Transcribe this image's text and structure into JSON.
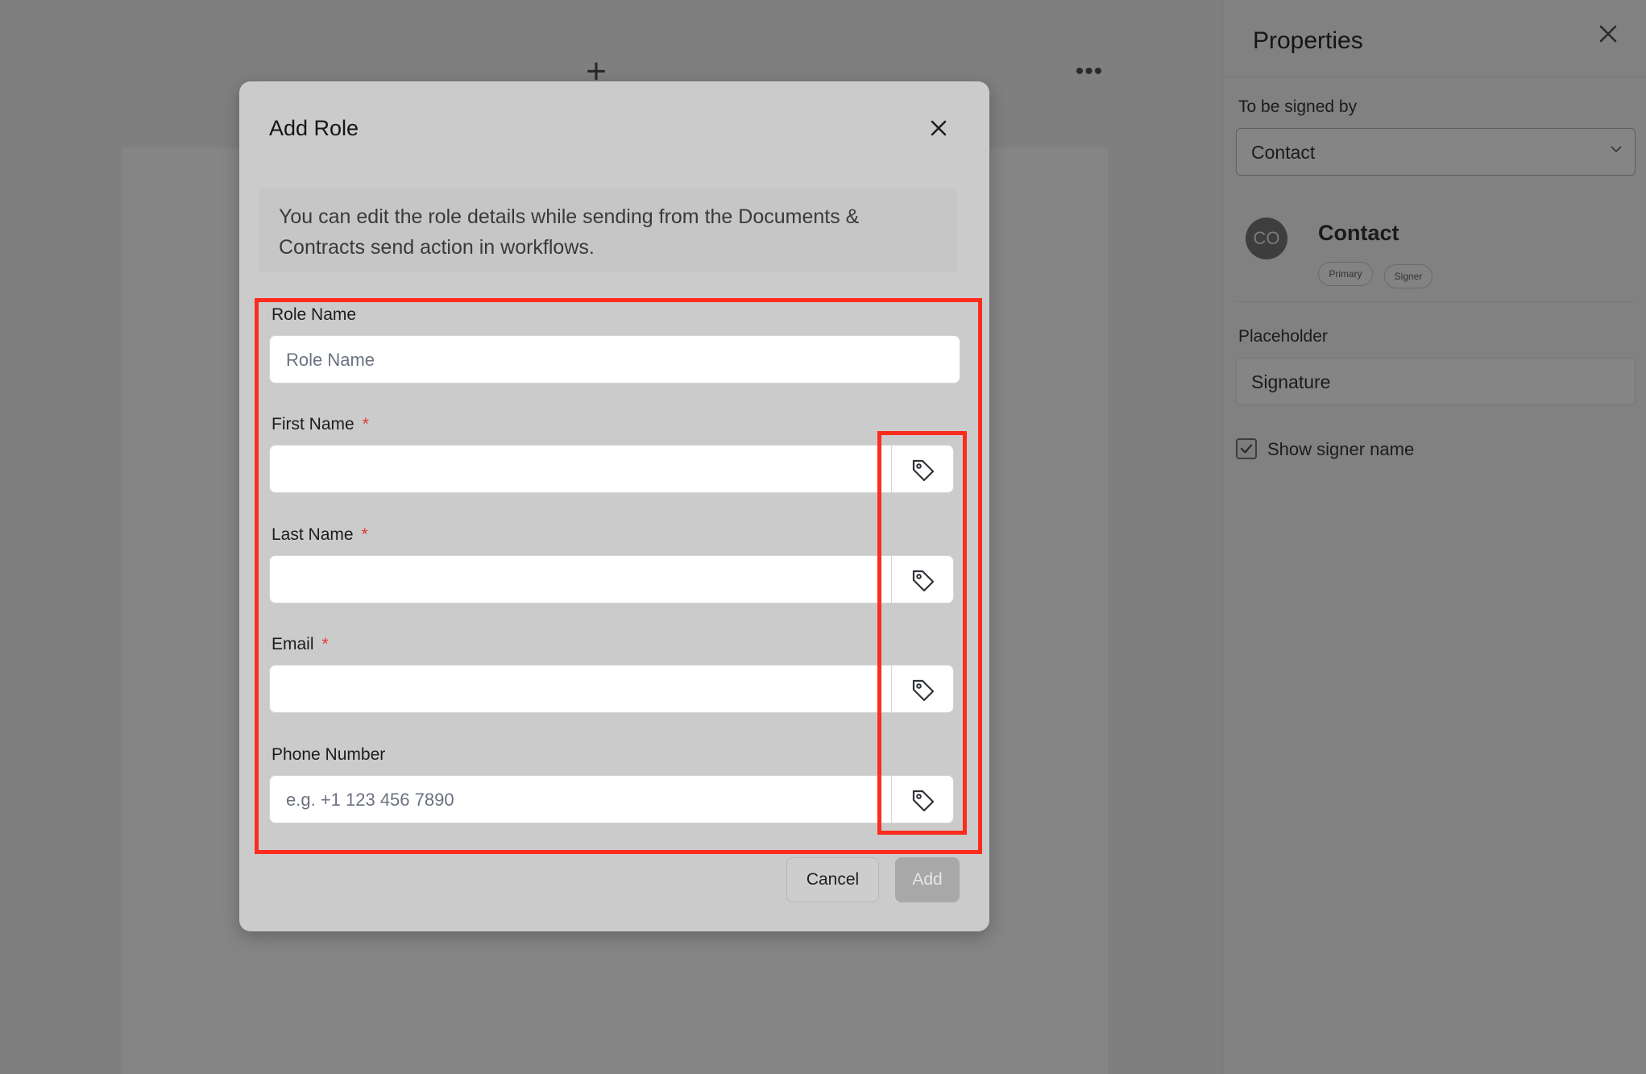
{
  "background": {
    "add_icon": "plus-icon",
    "more_icon": "more-horizontal-icon"
  },
  "properties_panel": {
    "title": "Properties",
    "close_icon": "close-icon",
    "signed_by_label": "To be signed by",
    "signed_by_value": "Contact",
    "contact": {
      "avatar_initials": "CO",
      "name": "Contact",
      "badges": [
        "Primary",
        "Signer"
      ]
    },
    "placeholder_label": "Placeholder",
    "placeholder_value": "Signature",
    "show_signer_name_label": "Show signer name",
    "show_signer_name_checked": true
  },
  "modal": {
    "title": "Add Role",
    "info_text": "You can edit the role details while sending from the Documents & Contracts send action in workflows.",
    "fields": {
      "role_name": {
        "label": "Role Name",
        "placeholder": "Role Name",
        "required": false
      },
      "first_name": {
        "label": "First Name",
        "required": true,
        "required_mark": "*"
      },
      "last_name": {
        "label": "Last Name",
        "required": true,
        "required_mark": "*"
      },
      "email": {
        "label": "Email",
        "required": true,
        "required_mark": "*"
      },
      "phone_number": {
        "label": "Phone Number",
        "placeholder": "e.g. +1 123 456 7890",
        "required": false
      }
    },
    "cancel_label": "Cancel",
    "add_label": "Add"
  },
  "colors": {
    "overlay": "#808080",
    "modal_bg": "#cbcbcb",
    "highlight": "#ff2b1c",
    "required": "#e53935",
    "add_disabled": "#a8a8a8"
  }
}
